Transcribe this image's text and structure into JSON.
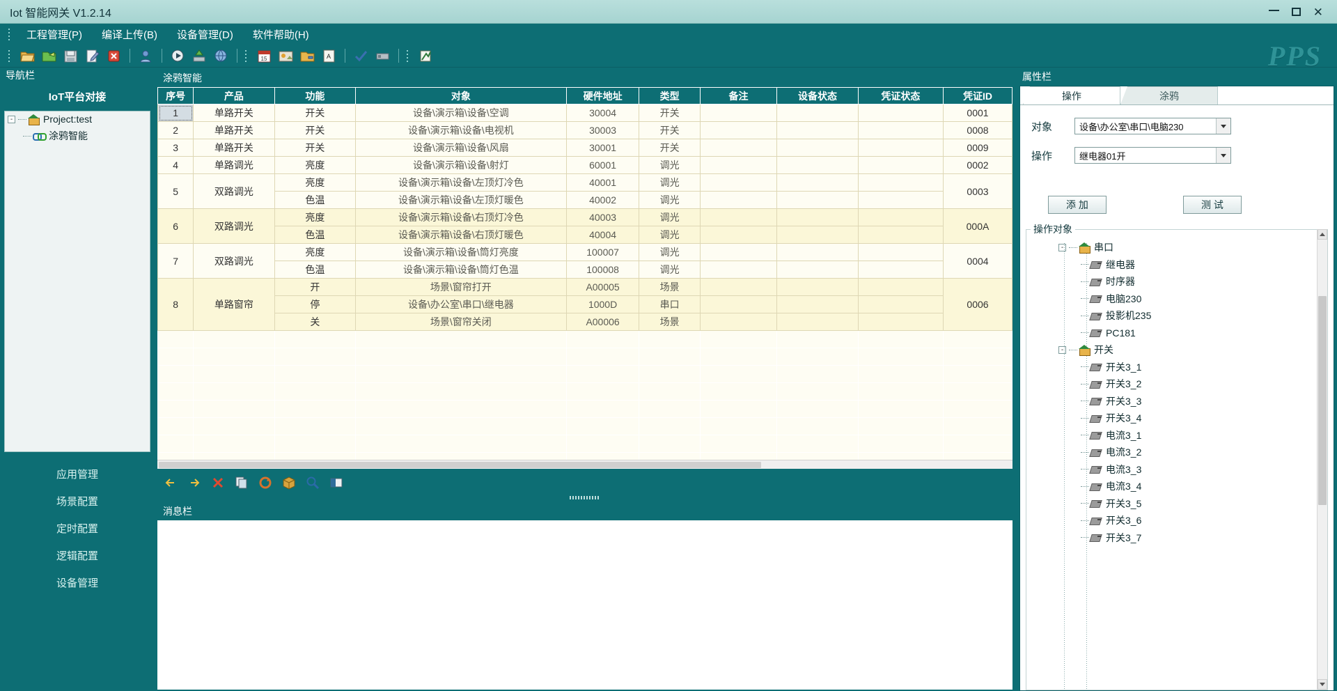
{
  "window": {
    "title": "Iot 智能网关 V1.2.14",
    "buttons": {
      "minimize": "–",
      "maximize": "□",
      "close": "✕"
    }
  },
  "menubar": {
    "items": [
      {
        "label": "工程管理(P)"
      },
      {
        "label": "编译上传(B)"
      },
      {
        "label": "设备管理(D)"
      },
      {
        "label": "软件帮助(H)"
      }
    ]
  },
  "toolbar": {
    "icons": [
      "open-folder-icon",
      "save-as-folder-icon",
      "save-icon",
      "edit-icon",
      "delete-icon",
      "user-icon",
      "run-icon",
      "upload-icon",
      "network-icon",
      "calendar-icon",
      "scene-icon",
      "folder-export-icon",
      "text-icon",
      "check-icon",
      "device-list-icon",
      "logic-icon"
    ],
    "logo": "PPS"
  },
  "leftnav": {
    "caption": "导航栏",
    "platform_title": "IoT平台对接",
    "tree": [
      {
        "label": "Project:test",
        "icon": "home-icon",
        "level": 1,
        "expander": "-"
      },
      {
        "label": "涂鸦智能",
        "icon": "link-icon",
        "level": 2,
        "expander": ""
      }
    ],
    "links": [
      {
        "label": "应用管理"
      },
      {
        "label": "场景配置"
      },
      {
        "label": "定时配置"
      },
      {
        "label": "逻辑配置"
      },
      {
        "label": "设备管理"
      }
    ]
  },
  "grid": {
    "caption": "涂鸦智能",
    "columns": [
      "序号",
      "产品",
      "功能",
      "对象",
      "硬件地址",
      "类型",
      "备注",
      "设备状态",
      "凭证状态",
      "凭证ID"
    ],
    "rows": [
      {
        "seq": "1",
        "product": "单路开关",
        "func": "开关",
        "object": "设备\\演示箱\\设备\\空调",
        "addr": "30004",
        "type": "开关",
        "note": "",
        "devstate": "",
        "credstate": "",
        "credid": "0001",
        "span": 1,
        "selected": true
      },
      {
        "seq": "2",
        "product": "单路开关",
        "func": "开关",
        "object": "设备\\演示箱\\设备\\电视机",
        "addr": "30003",
        "type": "开关",
        "note": "",
        "devstate": "",
        "credstate": "",
        "credid": "0008",
        "span": 1
      },
      {
        "seq": "3",
        "product": "单路开关",
        "func": "开关",
        "object": "设备\\演示箱\\设备\\风扇",
        "addr": "30001",
        "type": "开关",
        "note": "",
        "devstate": "",
        "credstate": "",
        "credid": "0009",
        "span": 1
      },
      {
        "seq": "4",
        "product": "单路调光",
        "func": "亮度",
        "object": "设备\\演示箱\\设备\\射灯",
        "addr": "60001",
        "type": "调光",
        "note": "",
        "devstate": "",
        "credstate": "",
        "credid": "0002",
        "span": 1
      },
      {
        "seq": "5",
        "product": "双路调光",
        "span": 2,
        "credid": "0003",
        "sub": [
          {
            "func": "亮度",
            "object": "设备\\演示箱\\设备\\左顶灯冷色",
            "addr": "40001",
            "type": "调光"
          },
          {
            "func": "色温",
            "object": "设备\\演示箱\\设备\\左顶灯暖色",
            "addr": "40002",
            "type": "调光"
          }
        ]
      },
      {
        "seq": "6",
        "product": "双路调光",
        "span": 2,
        "credid": "000A",
        "alt": true,
        "sub": [
          {
            "func": "亮度",
            "object": "设备\\演示箱\\设备\\右顶灯冷色",
            "addr": "40003",
            "type": "调光"
          },
          {
            "func": "色温",
            "object": "设备\\演示箱\\设备\\右顶灯暖色",
            "addr": "40004",
            "type": "调光"
          }
        ]
      },
      {
        "seq": "7",
        "product": "双路调光",
        "span": 2,
        "credid": "0004",
        "sub": [
          {
            "func": "亮度",
            "object": "设备\\演示箱\\设备\\筒灯亮度",
            "addr": "100007",
            "type": "调光"
          },
          {
            "func": "色温",
            "object": "设备\\演示箱\\设备\\筒灯色温",
            "addr": "100008",
            "type": "调光"
          }
        ]
      },
      {
        "seq": "8",
        "product": "单路窗帘",
        "span": 3,
        "credid": "0006",
        "alt": true,
        "sub": [
          {
            "func": "开",
            "object": "场景\\窗帘打开",
            "addr": "A00005",
            "type": "场景"
          },
          {
            "func": "停",
            "object": "设备\\办公室\\串口\\继电器",
            "addr": "1000D",
            "type": "串口"
          },
          {
            "func": "关",
            "object": "场景\\窗帘关闭",
            "addr": "A00006",
            "type": "场景"
          }
        ]
      }
    ]
  },
  "mini_toolbar": {
    "icons": [
      "prev-icon",
      "next-icon",
      "delete-red-icon",
      "copy-icon",
      "refresh-icon",
      "package-icon",
      "search-icon",
      "export-icon"
    ]
  },
  "message": {
    "caption": "消息栏",
    "content": ""
  },
  "properties": {
    "caption": "属性栏",
    "tabs": [
      {
        "label": "操作",
        "active": true
      },
      {
        "label": "涂鸦",
        "active": false
      }
    ],
    "fields": [
      {
        "label": "对象",
        "value": "设备\\办公室\\串口\\电脑230"
      },
      {
        "label": "操作",
        "value": "继电器01开"
      }
    ],
    "buttons": [
      {
        "label": "添 加",
        "name": "add-button"
      },
      {
        "label": "测 试",
        "name": "test-button"
      }
    ],
    "op_group_title": "操作对象",
    "op_tree": [
      {
        "label": "串口",
        "level": 0,
        "icon": "home-icon",
        "expander": "-"
      },
      {
        "label": "继电器",
        "level": 1,
        "icon": "device-icon"
      },
      {
        "label": "时序器",
        "level": 1,
        "icon": "device-icon"
      },
      {
        "label": "电脑230",
        "level": 1,
        "icon": "device-icon"
      },
      {
        "label": "投影机235",
        "level": 1,
        "icon": "device-icon"
      },
      {
        "label": "PC181",
        "level": 1,
        "icon": "device-icon"
      },
      {
        "label": "开关",
        "level": 0,
        "icon": "home-icon",
        "expander": "-"
      },
      {
        "label": "开关3_1",
        "level": 1,
        "icon": "device-icon"
      },
      {
        "label": "开关3_2",
        "level": 1,
        "icon": "device-icon"
      },
      {
        "label": "开关3_3",
        "level": 1,
        "icon": "device-icon"
      },
      {
        "label": "开关3_4",
        "level": 1,
        "icon": "device-icon"
      },
      {
        "label": "电流3_1",
        "level": 1,
        "icon": "device-icon"
      },
      {
        "label": "电流3_2",
        "level": 1,
        "icon": "device-icon"
      },
      {
        "label": "电流3_3",
        "level": 1,
        "icon": "device-icon"
      },
      {
        "label": "电流3_4",
        "level": 1,
        "icon": "device-icon"
      },
      {
        "label": "开关3_5",
        "level": 1,
        "icon": "device-icon"
      },
      {
        "label": "开关3_6",
        "level": 1,
        "icon": "device-icon"
      },
      {
        "label": "开关3_7",
        "level": 1,
        "icon": "device-icon"
      }
    ]
  },
  "colors": {
    "teal": "#0d6e74",
    "title_bar": "#aed6d3",
    "row_alt": "#fbf7d8",
    "row_base": "#fefdf3",
    "selected_cell": "#d4dde3"
  }
}
